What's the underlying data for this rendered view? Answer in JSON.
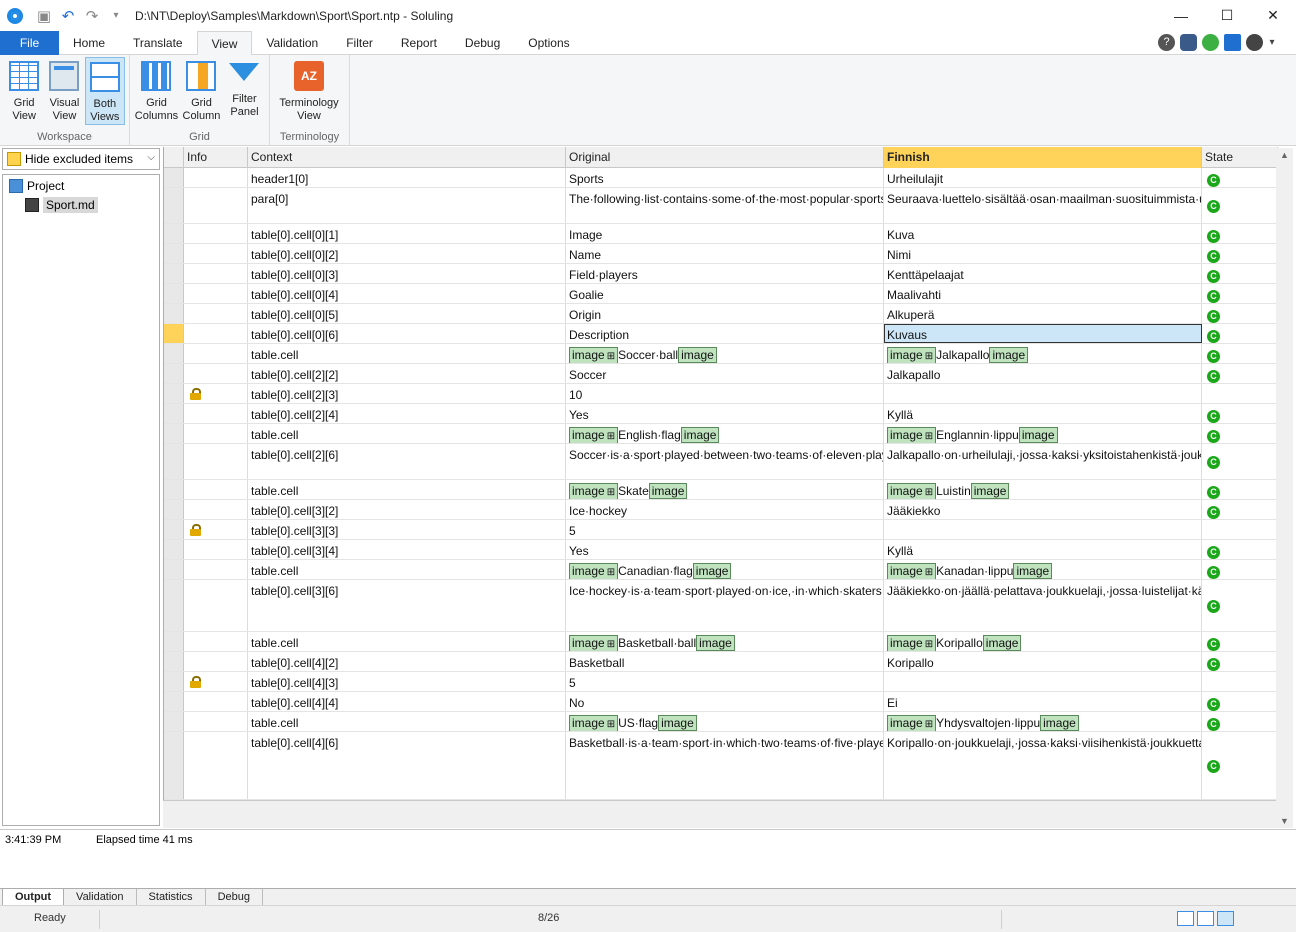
{
  "window": {
    "title": "D:\\NT\\Deploy\\Samples\\Markdown\\Sport\\Sport.ntp  -  Soluling",
    "controls": [
      "—",
      "☐",
      "✕"
    ]
  },
  "menu": {
    "items": [
      "File",
      "Home",
      "Translate",
      "View",
      "Validation",
      "Filter",
      "Report",
      "Debug",
      "Options"
    ],
    "active": "View"
  },
  "ribbon": {
    "workspace": {
      "label": "Workspace",
      "grid_view": "Grid View",
      "visual_view": "Visual View",
      "both_views": "Both Views"
    },
    "grid": {
      "label": "Grid",
      "grid_columns": "Grid Columns",
      "grid_column": "Grid Column",
      "filter_panel": "Filter Panel"
    },
    "terminology": {
      "label": "Terminology",
      "terminology_view": "Terminology View",
      "icon_text": "AZ"
    }
  },
  "left": {
    "filter": "Hide excluded items",
    "tree": {
      "project": "Project",
      "file": "Sport.md"
    }
  },
  "grid": {
    "headers": [
      "Info",
      "Context",
      "Original",
      "Finnish",
      "State"
    ],
    "rows": [
      {
        "context": "header1[0]",
        "original": "Sports",
        "finnish": "Urheilulajit",
        "state": "C"
      },
      {
        "context": "para[0]",
        "original": "The·following·list·contains·some·of·the·most·popular·sports·in·the·world.",
        "finnish": "Seuraava·luettelo·sisältää·osan·maailman·suosituimmista·urheilulajeista.",
        "state": "C"
      },
      {
        "context": "table[0].cell[0][1]",
        "original": "Image",
        "finnish": "Kuva",
        "state": "C"
      },
      {
        "context": "table[0].cell[0][2]",
        "original": "Name",
        "finnish": "Nimi",
        "state": "C"
      },
      {
        "context": "table[0].cell[0][3]",
        "original": "Field·players",
        "finnish": "Kenttäpelaajat",
        "state": "C"
      },
      {
        "context": "table[0].cell[0][4]",
        "original": "Goalie",
        "finnish": "Maalivahti",
        "state": "C"
      },
      {
        "context": "table[0].cell[0][5]",
        "original": "Origin",
        "finnish": "Alkuperä",
        "state": "C"
      },
      {
        "context": "table[0].cell[0][6]",
        "original": "Description",
        "finnish": "Kuvaus",
        "state": "C"
      },
      {
        "context": "table.cell",
        "original_tag": "image",
        "original": "Soccer·ball",
        "original_end": "image",
        "finnish_tag": "image",
        "finnish": "Jalkapallo",
        "finnish_end": "image",
        "state": "C"
      },
      {
        "context": "table[0].cell[2][2]",
        "original": "Soccer",
        "finnish": "Jalkapallo",
        "state": "C"
      },
      {
        "context": "table[0].cell[2][3]",
        "original": "10",
        "finnish": "",
        "state": ""
      },
      {
        "context": "table[0].cell[2][4]",
        "original": "Yes",
        "finnish": "Kyllä",
        "state": "C"
      },
      {
        "context": "table.cell",
        "original_tag": "image",
        "original": "English·flag",
        "original_end": "image",
        "finnish_tag": "image",
        "finnish": "Englannin·lippu",
        "finnish_end": "image",
        "state": "C"
      },
      {
        "context": "table[0].cell[2][6]",
        "original": "Soccer·is·a·sport·played·between·two·teams·of·eleven·players·with·a·spherical·ball.",
        "finnish": "Jalkapallo·on·urheilulaji,·jossa·kaksi·yksitoistahenkistä·joukkuetta·pelaavat·pallolla.",
        "state": "C"
      },
      {
        "context": "table.cell",
        "original_tag": "image",
        "original": "Skate",
        "original_end": "image",
        "finnish_tag": "image",
        "finnish": "Luistin",
        "finnish_end": "image",
        "state": "C"
      },
      {
        "context": "table[0].cell[3][2]",
        "original": "Ice·hockey",
        "finnish": "Jääkiekko",
        "state": "C"
      },
      {
        "context": "table[0].cell[3][3]",
        "original": "5",
        "finnish": "",
        "state": ""
      },
      {
        "context": "table[0].cell[3][4]",
        "original": "Yes",
        "finnish": "Kyllä",
        "state": "C"
      },
      {
        "context": "table.cell",
        "original_tag": "image",
        "original": "Canadian·flag",
        "original_end": "image",
        "finnish_tag": "image",
        "finnish": "Kanadan·lippu",
        "finnish_end": "image",
        "state": "C"
      },
      {
        "context": "table[0].cell[3][6]",
        "original": "Ice·hockey·is·a·team·sport·played·on·ice,·in·which·skaters·use·sticks·to·direct·a·puck·into·the·opposing·team's·goal.",
        "finnish": "Jääkiekko·on·jäällä·pelattava·joukkuelaji,·jossa·luistelijat·käyttävät·mailaa·saadakseen·kiekon·vastajoukkueen·maaliin.",
        "state": "C"
      },
      {
        "context": "table.cell",
        "original_tag": "image",
        "original": "Basketball·ball",
        "original_end": "image",
        "finnish_tag": "image",
        "finnish": "Koripallo",
        "finnish_end": "image",
        "state": "C"
      },
      {
        "context": "table[0].cell[4][2]",
        "original": "Basketball",
        "finnish": "Koripallo",
        "state": "C"
      },
      {
        "context": "table[0].cell[4][3]",
        "original": "5",
        "finnish": "",
        "state": ""
      },
      {
        "context": "table[0].cell[4][4]",
        "original": "No",
        "finnish": "Ei",
        "state": "C"
      },
      {
        "context": "table.cell",
        "original_tag": "image",
        "original": "US·flag",
        "original_end": "image",
        "finnish_tag": "image",
        "finnish": "Yhdysvaltojen·lippu",
        "finnish_end": "image",
        "state": "C"
      },
      {
        "context": "table[0].cell[4][6]",
        "original": "Basketball·is·a·team·sport·in·which·two·teams·of·five·players·try·to·score·points·by·throwing·a·ball·through·the·top·of·a·basketball·hoop·while·following·a·set·of·rules.",
        "finnish": "Koripallo·on·joukkuelaji,·jossa·kaksi·viisihenkistä·joukkuetta·yrittää·tehdä·pisteitä·heittämällä·pallon·korin·läpi·samalla·noudattaen·sääntöjä.",
        "state": "C"
      }
    ]
  },
  "output": {
    "time": "3:41:39 PM",
    "message": "Elapsed time 41 ms"
  },
  "tabs": [
    "Output",
    "Validation",
    "Statistics",
    "Debug"
  ],
  "status": {
    "ready": "Ready",
    "position": "8/26"
  }
}
